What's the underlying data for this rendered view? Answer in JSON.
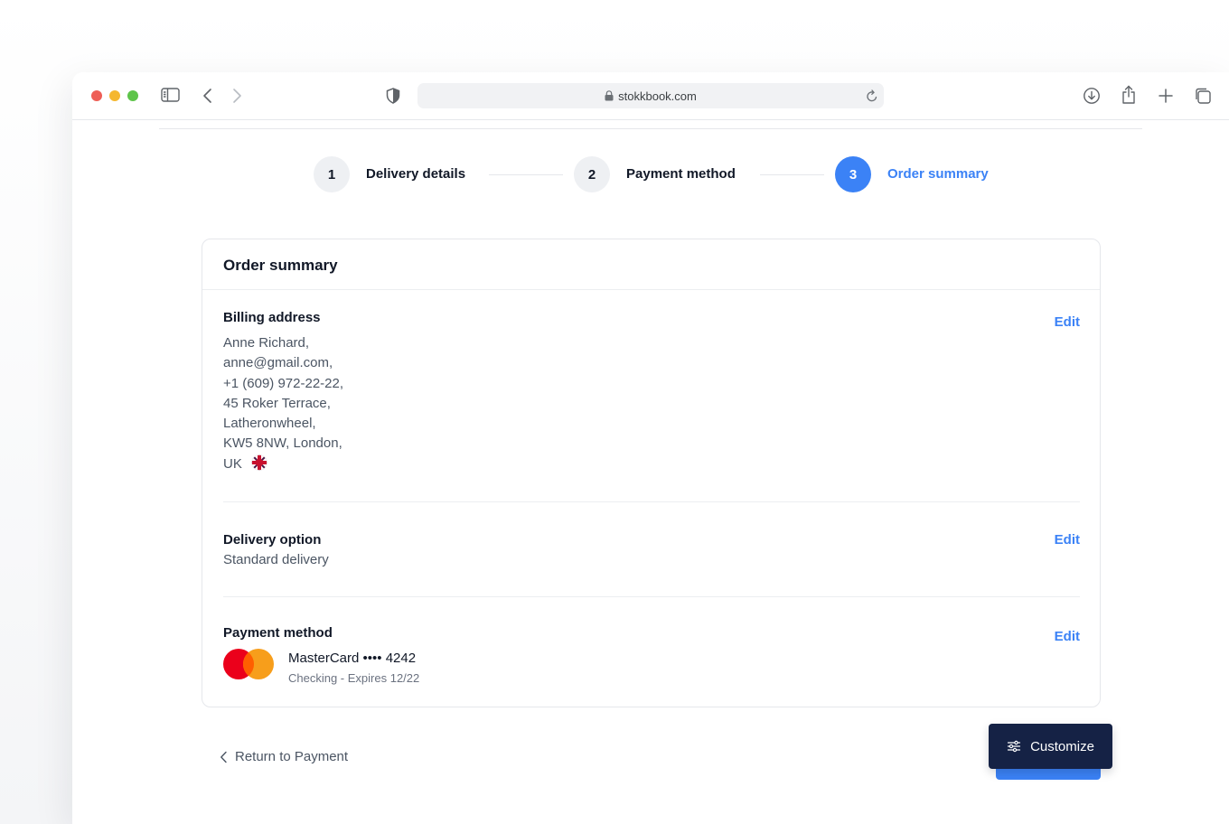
{
  "browser": {
    "url": "stokkbook.com"
  },
  "stepper": {
    "steps": [
      {
        "number": "1",
        "label": "Delivery details"
      },
      {
        "number": "2",
        "label": "Payment method"
      },
      {
        "number": "3",
        "label": "Order summary"
      }
    ],
    "active_step": 3
  },
  "summary": {
    "title": "Order summary",
    "billing": {
      "title": "Billing address",
      "edit_label": "Edit",
      "lines": [
        "Anne Richard,",
        "anne@gmail.com,",
        "+1 (609) 972-22-22,",
        "45 Roker Terrace,",
        "Latheronwheel,",
        "KW5 8NW, London,",
        "UK"
      ],
      "flag_icon": "uk-flag-icon"
    },
    "delivery": {
      "title": "Delivery option",
      "edit_label": "Edit",
      "value": "Standard delivery"
    },
    "payment": {
      "title": "Payment method",
      "edit_label": "Edit",
      "card_name": "MasterCard •••• 4242",
      "card_sub": "Checking - Expires 12/22",
      "logo_icon": "mastercard-logo"
    }
  },
  "footer": {
    "return_label": "Return to Payment",
    "customize_label": "Customize"
  },
  "colors": {
    "accent": "#3b82f6",
    "dark_button": "#152245",
    "mastercard_red": "#eb001b",
    "mastercard_orange": "#f79e1b"
  }
}
